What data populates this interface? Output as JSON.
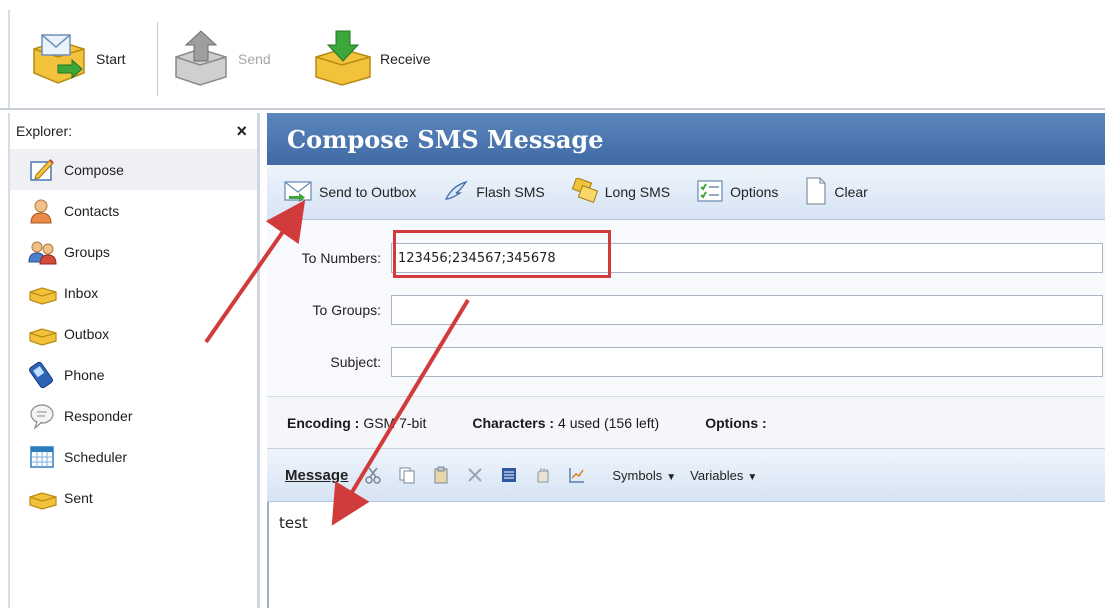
{
  "toolbar": {
    "start_label": "Start",
    "send_label": "Send",
    "receive_label": "Receive"
  },
  "explorer": {
    "title": "Explorer:",
    "close_glyph": "×",
    "items": [
      {
        "label": "Compose",
        "icon": "compose-icon"
      },
      {
        "label": "Contacts",
        "icon": "contact-person-icon"
      },
      {
        "label": "Groups",
        "icon": "group-people-icon"
      },
      {
        "label": "Inbox",
        "icon": "inbox-tray-icon"
      },
      {
        "label": "Outbox",
        "icon": "outbox-tray-icon"
      },
      {
        "label": "Phone",
        "icon": "phone-icon"
      },
      {
        "label": "Responder",
        "icon": "speech-bubble-icon"
      },
      {
        "label": "Scheduler",
        "icon": "calendar-icon"
      },
      {
        "label": "Sent",
        "icon": "sent-tray-icon"
      }
    ],
    "selected": "Compose"
  },
  "compose": {
    "title": "Compose SMS Message",
    "actions": {
      "send_to_outbox": "Send to Outbox",
      "flash_sms": "Flash SMS",
      "long_sms": "Long SMS",
      "options": "Options",
      "clear": "Clear"
    },
    "fields": {
      "to_numbers_label": "To Numbers:",
      "to_numbers_value": "123456;234567;345678",
      "to_groups_label": "To Groups:",
      "to_groups_value": "",
      "subject_label": "Subject:",
      "subject_value": ""
    },
    "status": {
      "encoding_key": "Encoding :",
      "encoding_value": "GSM 7-bit",
      "characters_key": "Characters :",
      "characters_value": "4 used (156 left)",
      "options_key": "Options :"
    },
    "message": {
      "label": "Message",
      "symbols_menu": "Symbols",
      "variables_menu": "Variables",
      "body": "test"
    }
  },
  "colors": {
    "title_bar": "#4a77b1",
    "annotation": "#d23b3b",
    "toolbar_gradient_top": "#eef4fb",
    "toolbar_gradient_bottom": "#d7e4f4"
  }
}
